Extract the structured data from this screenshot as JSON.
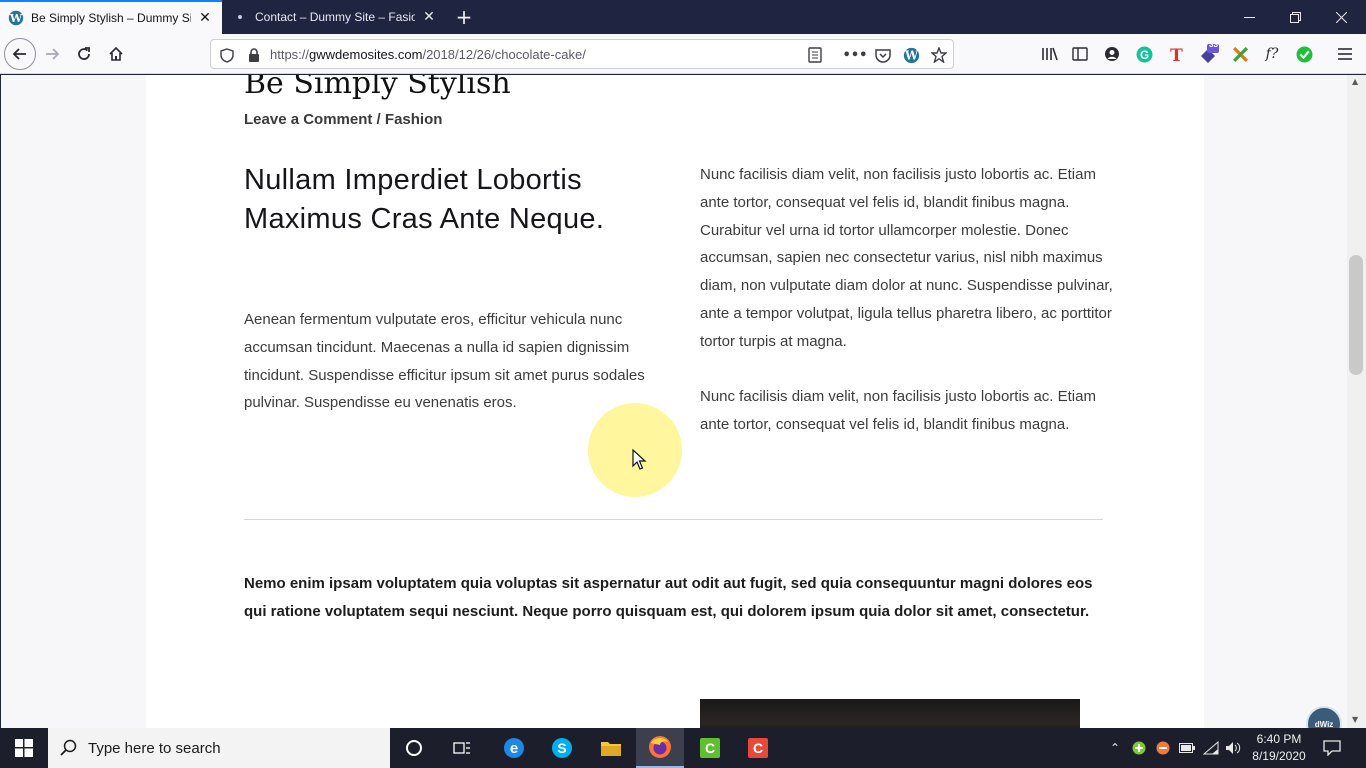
{
  "browser": {
    "tabs": [
      {
        "title": "Be Simply Stylish – Dummy Site",
        "active": true
      },
      {
        "title": "Contact – Dummy Site – Fasion",
        "active": false
      }
    ],
    "url": {
      "prefix": "https://",
      "host": "gwwdemosites.com",
      "path": "/2018/12/26/chocolate-cake/"
    },
    "extension_badge_count": "33"
  },
  "page": {
    "site_title": "Be Simply Stylish",
    "meta": {
      "comment_link": "Leave a Comment",
      "separator": " / ",
      "category": "Fashion"
    },
    "heading": "Nullam Imperdiet Lobortis Maximus Cras Ante Neque.",
    "left_paragraph": "Aenean fermentum vulputate eros, efficitur vehicula nunc accumsan tincidunt. Maecenas a nulla id sapien dignissim tincidunt. Suspendisse efficitur ipsum sit amet purus sodales pulvinar. Suspendisse eu venenatis eros.",
    "right_paragraph_1": "Nunc facilisis diam velit, non facilisis justo lobortis ac. Etiam ante tortor, consequat vel felis id, blandit finibus magna. Curabitur vel urna id tortor ullamcorper molestie. Donec accumsan, sapien nec consectetur varius, nisl nibh maximus diam, non vulputate diam dolor at nunc. Suspendisse pulvinar, ante a tempor volutpat, ligula tellus pharetra libero, ac porttitor tortor turpis at magna.",
    "right_paragraph_2": "Nunc facilisis diam velit, non facilisis justo lobortis ac. Etiam ante tortor, consequat vel felis id, blandit finibus magna.",
    "bold_paragraph": "Nemo enim ipsam voluptatem quia voluptas sit aspernatur aut odit aut fugit, sed quia consequuntur magni dolores eos qui ratione voluptatem sequi nesciunt. Neque porro quisquam est, qui dolorem ipsum quia dolor sit amet, consectetur."
  },
  "overlay_badge": "dWiz",
  "taskbar": {
    "search_placeholder": "Type here to search",
    "time": "6:40 PM",
    "date": "8/19/2020"
  },
  "colors": {
    "tab_bar": "#1f2440",
    "accent": "#0a84ff",
    "cursor_highlight": "#fff48c"
  }
}
